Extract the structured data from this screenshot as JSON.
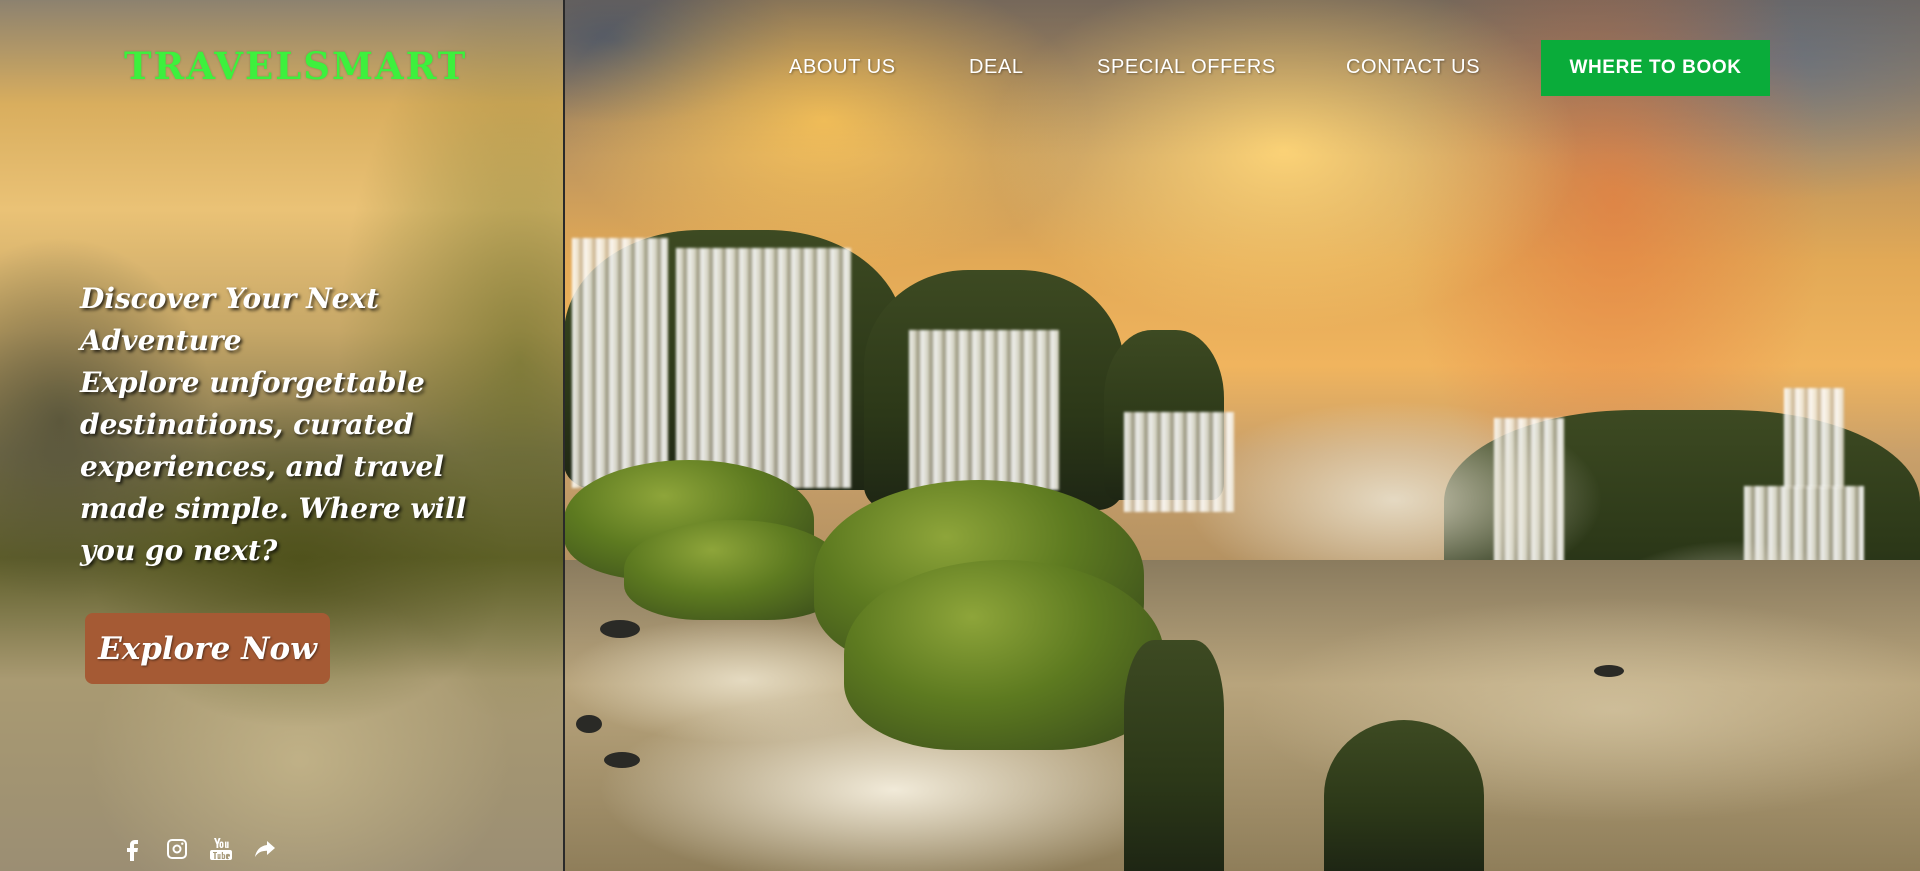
{
  "brand": {
    "name": "TRAVELSMART",
    "color": "#3df03d"
  },
  "nav": {
    "links": [
      "ABOUT US",
      "DEAL",
      "SPECIAL OFFERS",
      "CONTACT US"
    ],
    "cta_label": "WHERE TO BOOK",
    "cta_color": "#0aac3a"
  },
  "hero": {
    "headline": "Discover Your Next Adventure",
    "body": "Explore unforgettable destinations, curated experiences, and travel made simple. Where will you go next?",
    "button_label": "Explore Now",
    "button_color": "#a55a34"
  },
  "socials": [
    {
      "name": "facebook-icon"
    },
    {
      "name": "instagram-icon"
    },
    {
      "name": "youtube-icon"
    },
    {
      "name": "share-icon"
    }
  ]
}
